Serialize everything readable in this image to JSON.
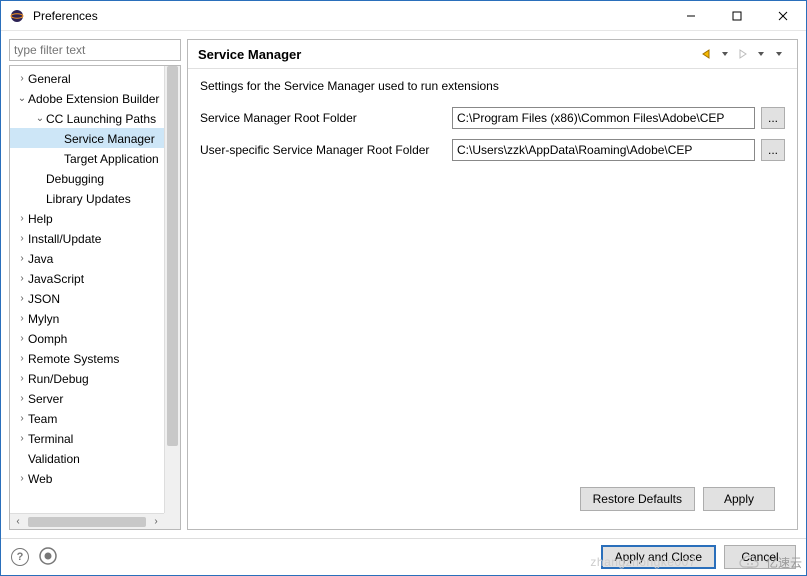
{
  "window": {
    "title": "Preferences"
  },
  "filter": {
    "placeholder": "type filter text"
  },
  "tree": {
    "items": [
      {
        "indent": 0,
        "twisty": "›",
        "label": "General",
        "selected": false
      },
      {
        "indent": 0,
        "twisty": "⌄",
        "label": "Adobe Extension Builder",
        "selected": false
      },
      {
        "indent": 1,
        "twisty": "⌄",
        "label": "CC Launching Paths",
        "selected": false
      },
      {
        "indent": 2,
        "twisty": "",
        "label": "Service Manager",
        "selected": true
      },
      {
        "indent": 2,
        "twisty": "",
        "label": "Target Application",
        "selected": false
      },
      {
        "indent": 1,
        "twisty": "",
        "label": "Debugging",
        "selected": false
      },
      {
        "indent": 1,
        "twisty": "",
        "label": "Library Updates",
        "selected": false
      },
      {
        "indent": 0,
        "twisty": "›",
        "label": "Help",
        "selected": false
      },
      {
        "indent": 0,
        "twisty": "›",
        "label": "Install/Update",
        "selected": false
      },
      {
        "indent": 0,
        "twisty": "›",
        "label": "Java",
        "selected": false
      },
      {
        "indent": 0,
        "twisty": "›",
        "label": "JavaScript",
        "selected": false
      },
      {
        "indent": 0,
        "twisty": "›",
        "label": "JSON",
        "selected": false
      },
      {
        "indent": 0,
        "twisty": "›",
        "label": "Mylyn",
        "selected": false
      },
      {
        "indent": 0,
        "twisty": "›",
        "label": "Oomph",
        "selected": false
      },
      {
        "indent": 0,
        "twisty": "›",
        "label": "Remote Systems",
        "selected": false
      },
      {
        "indent": 0,
        "twisty": "›",
        "label": "Run/Debug",
        "selected": false
      },
      {
        "indent": 0,
        "twisty": "›",
        "label": "Server",
        "selected": false
      },
      {
        "indent": 0,
        "twisty": "›",
        "label": "Team",
        "selected": false
      },
      {
        "indent": 0,
        "twisty": "›",
        "label": "Terminal",
        "selected": false
      },
      {
        "indent": 0,
        "twisty": "",
        "label": "Validation",
        "selected": false
      },
      {
        "indent": 0,
        "twisty": "›",
        "label": "Web",
        "selected": false
      }
    ]
  },
  "page": {
    "title": "Service Manager",
    "description": "Settings for the Service Manager used to run extensions",
    "fields": [
      {
        "label": "Service Manager Root Folder",
        "value": "C:\\Program Files (x86)\\Common Files\\Adobe\\CEP",
        "browse": "..."
      },
      {
        "label": "User-specific Service Manager Root Folder",
        "value": "C:\\Users\\zzk\\AppData\\Roaming\\Adobe\\CEP",
        "browse": "..."
      }
    ],
    "buttons": {
      "restore": "Restore Defaults",
      "apply": "Apply"
    }
  },
  "dialogButtons": {
    "applyClose": "Apply and Close",
    "cancel": "Cancel"
  },
  "watermark": "zhangzhongke007",
  "brand": "亿速云"
}
